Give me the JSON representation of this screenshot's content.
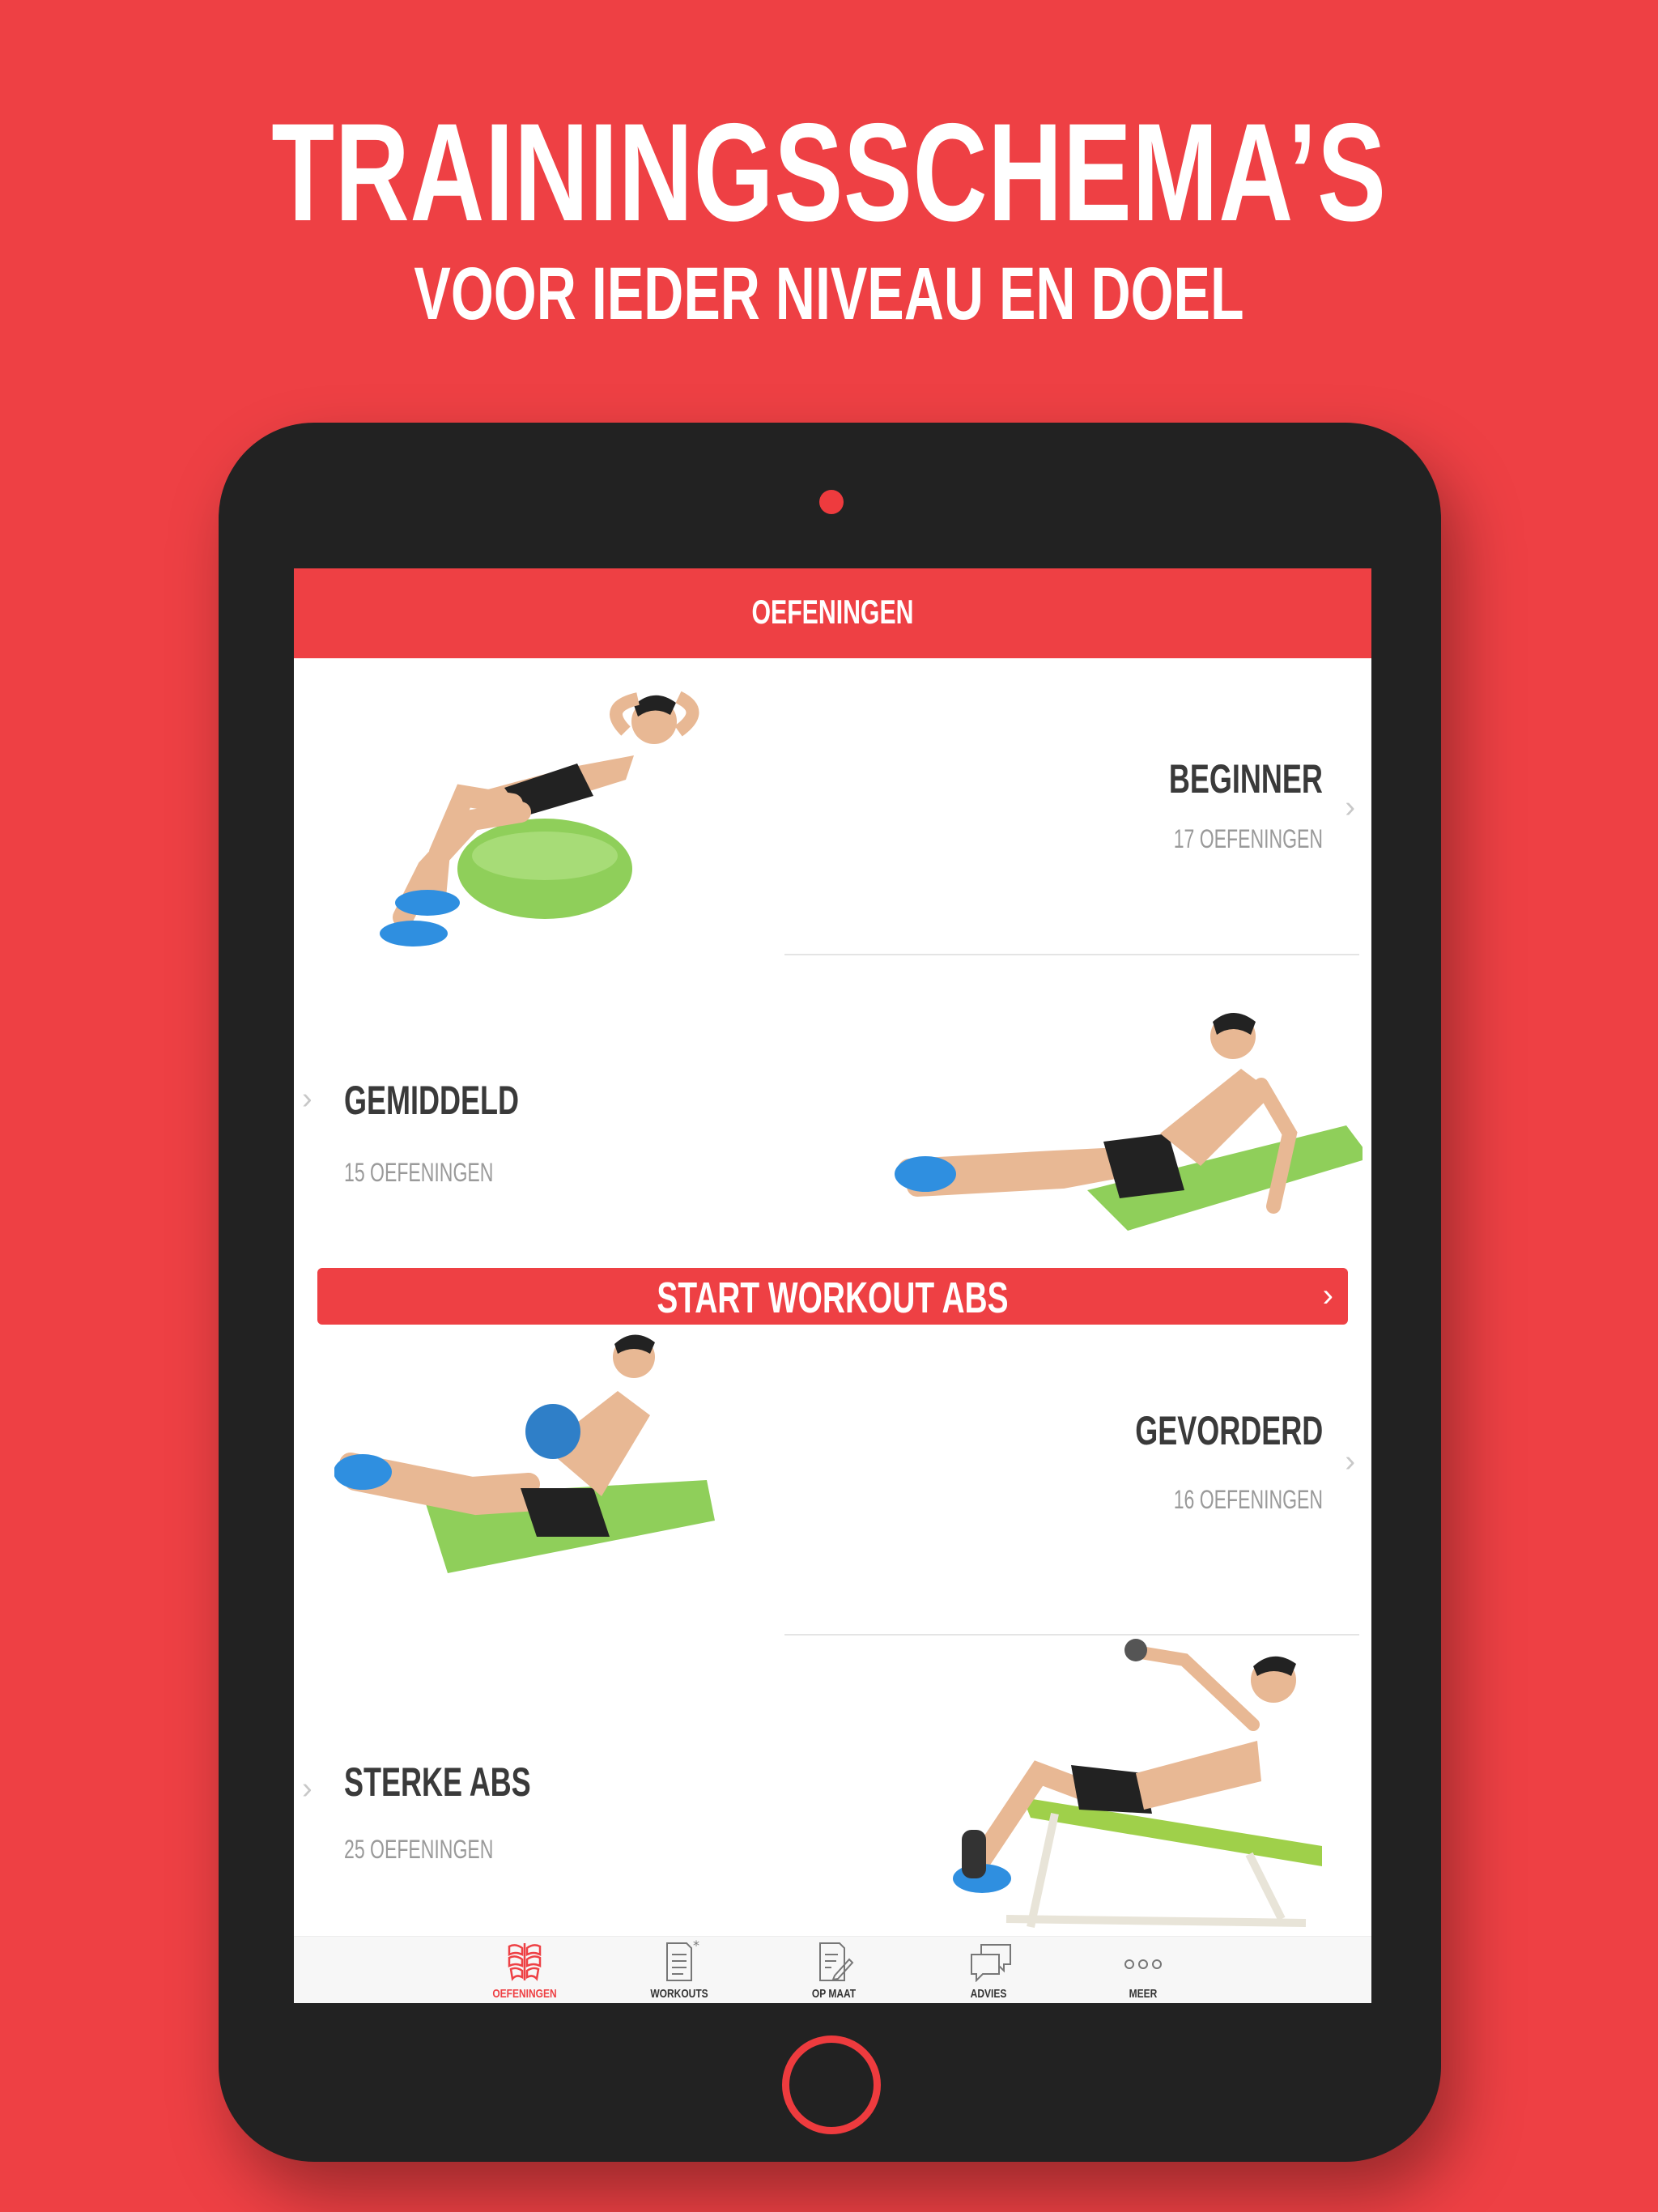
{
  "header": {
    "headline": "TRAININGSSCHEMA’S",
    "subheadline": "VOOR IEDER NIVEAU EN DOEL"
  },
  "app": {
    "nav_title": "OEFENINGEN",
    "levels": [
      {
        "title": "BEGINNER",
        "count": "17 OEFENINGEN"
      },
      {
        "title": "GEMIDDELD",
        "count": "15 OEFENINGEN"
      },
      {
        "title": "GEVORDERD",
        "count": "16 OEFENINGEN"
      },
      {
        "title": "STERKE ABS",
        "count": "25 OEFENINGEN"
      }
    ],
    "start_button": "START WORKOUT ABS",
    "tabs": [
      {
        "label": "OEFENINGEN",
        "icon": "abs-icon",
        "active": true
      },
      {
        "label": "WORKOUTS",
        "icon": "document-icon",
        "active": false
      },
      {
        "label": "OP MAAT",
        "icon": "edit-document-icon",
        "active": false
      },
      {
        "label": "ADVIES",
        "icon": "chat-icon",
        "active": false
      },
      {
        "label": "MEER",
        "icon": "more-icon",
        "active": false
      }
    ]
  },
  "colors": {
    "brand_red": "#ee4044",
    "device": "#222222",
    "title_text": "#3a3a3a",
    "sub_text": "#9a9a9a",
    "mat_green": "#8fcf5a"
  }
}
